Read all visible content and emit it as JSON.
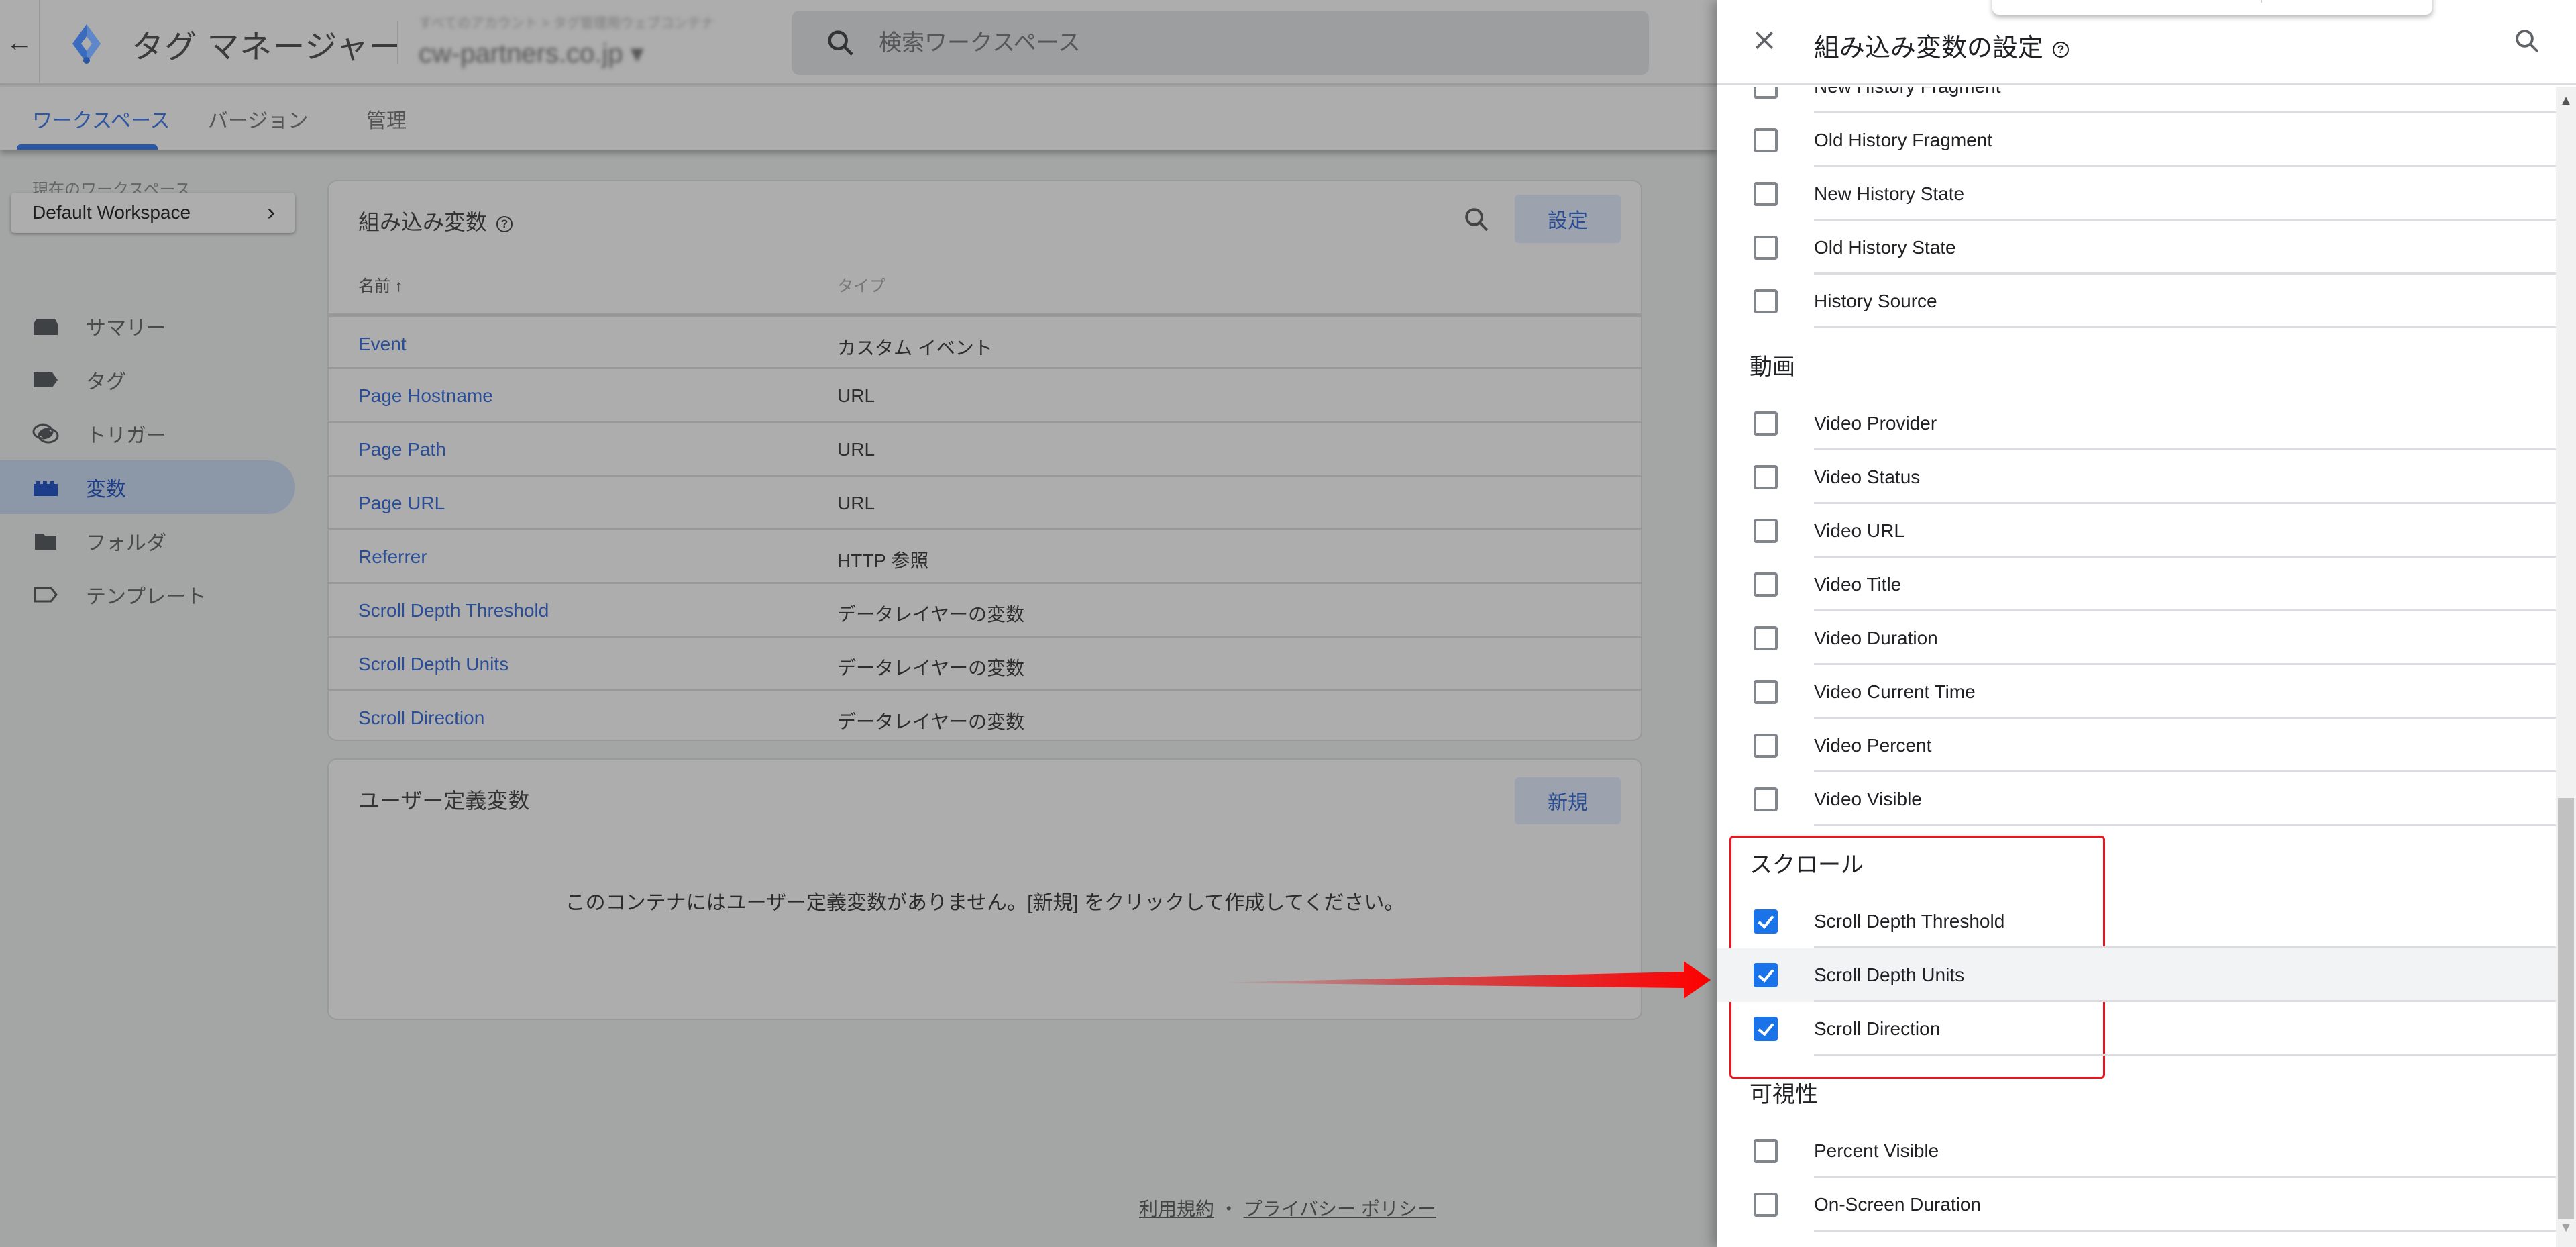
{
  "header": {
    "back_icon": "arrow-left-icon",
    "app_title": "タグ マネージャー",
    "account_line": "すべてのアカウント > タグ管理用ウェブコンテナ",
    "container_name": "cw-partners.co.jp",
    "search_placeholder": "検索ワークスペース"
  },
  "tabs": [
    {
      "label": "ワークスペース",
      "active": true
    },
    {
      "label": "バージョン",
      "active": false
    },
    {
      "label": "管理",
      "active": false
    }
  ],
  "sidebar": {
    "workspace_label": "現在のワークスペース",
    "workspace_name": "Default Workspace",
    "items": [
      {
        "label": "サマリー",
        "icon": "summary-icon"
      },
      {
        "label": "タグ",
        "icon": "tag-icon"
      },
      {
        "label": "トリガー",
        "icon": "trigger-icon"
      },
      {
        "label": "変数",
        "icon": "variable-icon",
        "active": true
      },
      {
        "label": "フォルダ",
        "icon": "folder-icon"
      },
      {
        "label": "テンプレート",
        "icon": "template-icon"
      }
    ]
  },
  "builtin_card": {
    "title": "組み込み変数",
    "configure_button": "設定",
    "columns": {
      "name": "名前 ↑",
      "type": "タイプ"
    },
    "rows": [
      {
        "name": "Event",
        "type": "カスタム イベント"
      },
      {
        "name": "Page Hostname",
        "type": "URL"
      },
      {
        "name": "Page Path",
        "type": "URL"
      },
      {
        "name": "Page URL",
        "type": "URL"
      },
      {
        "name": "Referrer",
        "type": "HTTP 参照"
      },
      {
        "name": "Scroll Depth Threshold",
        "type": "データレイヤーの変数"
      },
      {
        "name": "Scroll Depth Units",
        "type": "データレイヤーの変数"
      },
      {
        "name": "Scroll Direction",
        "type": "データレイヤーの変数"
      }
    ]
  },
  "user_card": {
    "title": "ユーザー定義変数",
    "new_button": "新規",
    "empty_message": "このコンテナにはユーザー定義変数がありません。[新規] をクリックして作成してください。"
  },
  "footer": {
    "terms": "利用規約",
    "separator": "・",
    "privacy": "プライバシー ポリシー"
  },
  "panel": {
    "title": "組み込み変数の設定",
    "partial_item": "New History Fragment",
    "history_items": [
      {
        "label": "Old History Fragment",
        "checked": false
      },
      {
        "label": "New History State",
        "checked": false
      },
      {
        "label": "Old History State",
        "checked": false
      },
      {
        "label": "History Source",
        "checked": false
      }
    ],
    "video_section": "動画",
    "video_items": [
      {
        "label": "Video Provider",
        "checked": false
      },
      {
        "label": "Video Status",
        "checked": false
      },
      {
        "label": "Video URL",
        "checked": false
      },
      {
        "label": "Video Title",
        "checked": false
      },
      {
        "label": "Video Duration",
        "checked": false
      },
      {
        "label": "Video Current Time",
        "checked": false
      },
      {
        "label": "Video Percent",
        "checked": false
      },
      {
        "label": "Video Visible",
        "checked": false
      }
    ],
    "scroll_section": "スクロール",
    "scroll_items": [
      {
        "label": "Scroll Depth Threshold",
        "checked": true
      },
      {
        "label": "Scroll Depth Units",
        "checked": true
      },
      {
        "label": "Scroll Direction",
        "checked": true
      }
    ],
    "visibility_section": "可視性",
    "visibility_items": [
      {
        "label": "Percent Visible",
        "checked": false
      },
      {
        "label": "On-Screen Duration",
        "checked": false
      }
    ]
  },
  "colors": {
    "accent": "#1a73e8",
    "link": "#2a4d96",
    "annotation_red": "#e9161d"
  }
}
